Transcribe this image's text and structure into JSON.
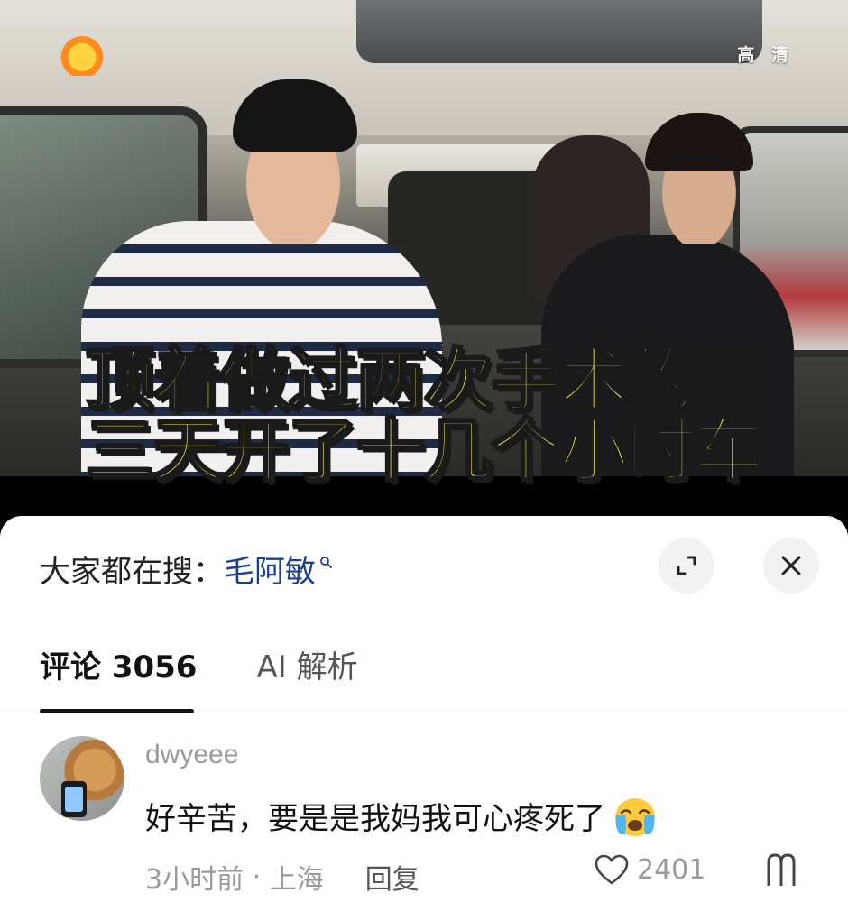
{
  "video": {
    "quality_badge": "高 清",
    "caption_line1": "顶着做过两次手术的腰",
    "caption_line2": "三天开了十几个小时车",
    "caption_color": "#f6e94a"
  },
  "search": {
    "prefix": "大家都在搜：",
    "term": "毛阿敏",
    "term_color": "#1d3f8f"
  },
  "tabs": [
    {
      "label": "评论 3056",
      "active": true
    },
    {
      "label": "AI 解析",
      "active": false
    }
  ],
  "comment": {
    "username": "dwyeee",
    "text": "好辛苦，要是是我妈我可心疼死了",
    "emoji": "loudly-crying-face",
    "time": "3小时前",
    "location": "上海",
    "reply_label": "回复",
    "like_count": "2401"
  },
  "icons": {
    "expand": "expand-icon",
    "close": "close-icon",
    "like": "heart-icon",
    "more": "more-icon"
  }
}
